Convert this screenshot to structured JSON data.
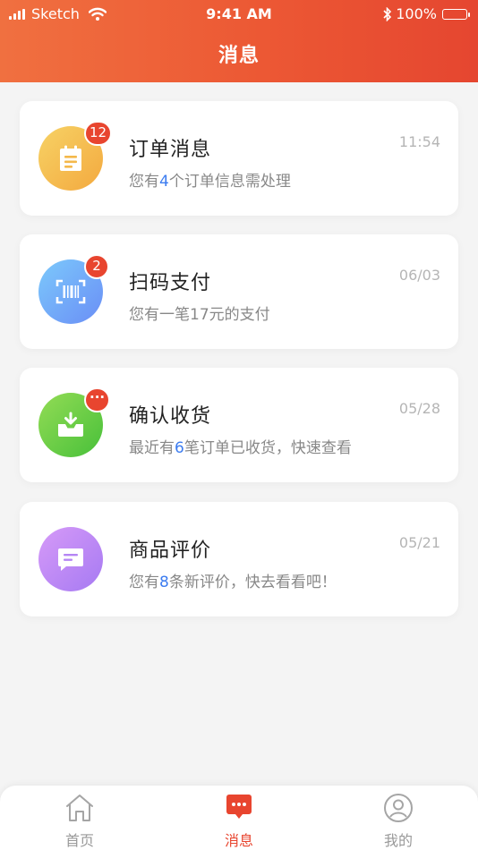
{
  "status_bar": {
    "carrier": "Sketch",
    "time": "9:41 AM",
    "battery": "100%"
  },
  "header": {
    "title": "消息"
  },
  "messages": [
    {
      "title": "订单消息",
      "time": "11:54",
      "badge": "12",
      "desc_before": "您有",
      "desc_num": "4",
      "desc_after": "个订单信息需处理",
      "icon": "clipboard-icon",
      "gradient": [
        "#f6d265",
        "#f4a93f"
      ]
    },
    {
      "title": "扫码支付",
      "time": "06/03",
      "badge": "2",
      "desc_before": "您有一笔17元的支付",
      "desc_num": "",
      "desc_after": "",
      "icon": "barcode-scan-icon",
      "gradient": [
        "#7cc9fb",
        "#6a8ef6"
      ]
    },
    {
      "title": "确认收货",
      "time": "05/28",
      "badge": "···",
      "desc_before": "最近有",
      "desc_num": "6",
      "desc_after": "笔订单已收货，快速查看",
      "icon": "inbox-download-icon",
      "gradient": [
        "#93dc55",
        "#48c03a"
      ]
    },
    {
      "title": "商品评价",
      "time": "05/21",
      "badge": "",
      "desc_before": "您有",
      "desc_num": "8",
      "desc_after": "条新评价，快去看看吧！",
      "icon": "comment-icon",
      "gradient": [
        "#d69af8",
        "#a67af2"
      ]
    }
  ],
  "tabbar": {
    "tabs": [
      {
        "label": "首页",
        "icon": "home-icon",
        "active": false
      },
      {
        "label": "消息",
        "icon": "chat-icon",
        "active": true
      },
      {
        "label": "我的",
        "icon": "user-icon",
        "active": false
      }
    ]
  },
  "colors": {
    "accent": "#e8452f",
    "link": "#3c7cf0"
  }
}
